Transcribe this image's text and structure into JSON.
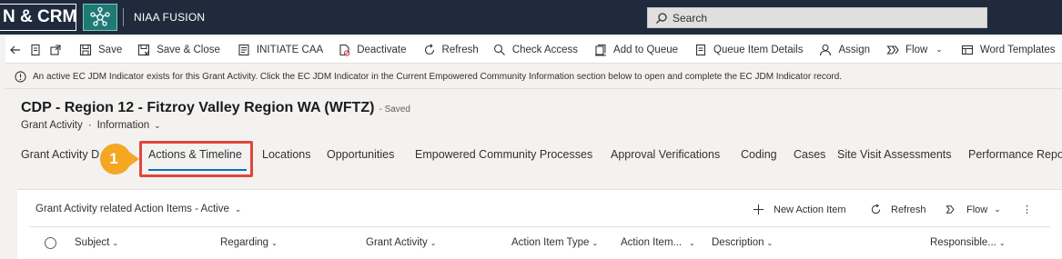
{
  "topbar": {
    "brand": "N & CRM",
    "app_name": "NIAA FUSION",
    "search_placeholder": "Search"
  },
  "command_bar": {
    "items": [
      {
        "label": "Save",
        "icon": "save-icon"
      },
      {
        "label": "Save & Close",
        "icon": "save-close-icon"
      },
      {
        "label": "INITIATE CAA",
        "icon": "document-icon"
      },
      {
        "label": "Deactivate",
        "icon": "deactivate-icon"
      },
      {
        "label": "Refresh",
        "icon": "refresh-icon"
      },
      {
        "label": "Check Access",
        "icon": "check-access-icon"
      },
      {
        "label": "Add to Queue",
        "icon": "queue-icon"
      },
      {
        "label": "Queue Item Details",
        "icon": "queue-details-icon"
      },
      {
        "label": "Assign",
        "icon": "person-icon"
      },
      {
        "label": "Flow",
        "icon": "flow-icon"
      },
      {
        "label": "Word Templates",
        "icon": "word-templates-icon"
      }
    ]
  },
  "notification": {
    "text": "An active EC JDM Indicator exists for this Grant Activity. Click the EC JDM Indicator in the Current Empowered Community Information section below to open and complete the EC JDM Indicator record."
  },
  "record": {
    "title": "CDP - Region 12 - Fitzroy Valley Region WA (WFTZ)",
    "status": "- Saved",
    "entity": "Grant Activity",
    "form": "Information"
  },
  "tabs": [
    {
      "label": "Grant Activity D"
    },
    {
      "label": "Actions & Timeline",
      "active": true
    },
    {
      "label": "Locations"
    },
    {
      "label": "Opportunities"
    },
    {
      "label": "Empowered Community Processes"
    },
    {
      "label": "Approval Verifications"
    },
    {
      "label": "Coding"
    },
    {
      "label": "Cases"
    },
    {
      "label": "Site Visit Assessments"
    },
    {
      "label": "Performance Repo"
    }
  ],
  "callout": {
    "number": "1",
    "color": "#f5a623"
  },
  "subgrid": {
    "title": "Grant Activity related Action Items - Active",
    "commands": {
      "new": "New Action Item",
      "refresh": "Refresh",
      "flow": "Flow",
      "more": "⋮"
    },
    "columns": [
      "Subject",
      "Regarding",
      "Grant Activity",
      "Action Item Type",
      "Action Item...",
      "Description",
      "Responsible..."
    ]
  },
  "colors": {
    "topbar": "#1f2b3d",
    "accent": "#0f6cbd",
    "highlight": "#e2453a"
  }
}
